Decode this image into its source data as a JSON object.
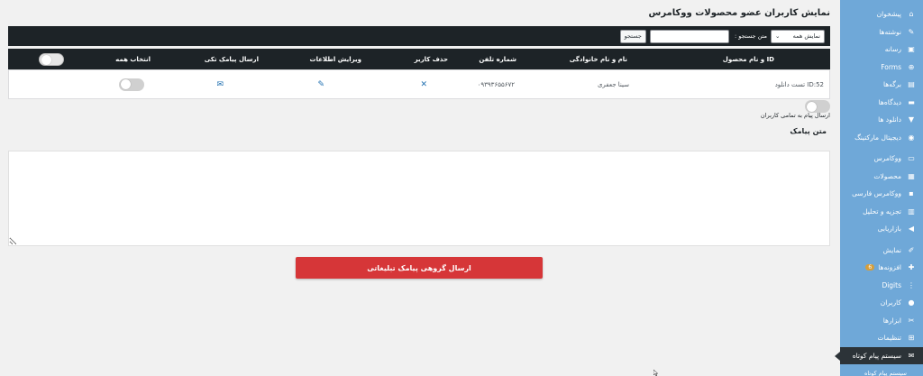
{
  "page": {
    "title": "نمایش کاربران عضو محصولات ووکامرس"
  },
  "toolbar": {
    "filter_value": "نمایش همه",
    "search_label": "متن جستجو :",
    "search_placeholder": "",
    "search_button": "جستجو"
  },
  "table": {
    "columns": {
      "id_product": "ID و نام محصول",
      "name": "نام و نام خانوادگی",
      "phone": "شماره تلفن",
      "delete": "حذف کاربر",
      "edit": "ویرایش اطلاعات",
      "single_sms": "ارسال پیامک تکی",
      "select_all": "انتخاب همه"
    },
    "rows": [
      {
        "id_product": "ID:52 تست دانلود",
        "name": "سینا جعفری",
        "phone": "۰۹۳۹۳۶۵۵۶۷۲"
      }
    ]
  },
  "bulk": {
    "all_users_label": "ارسال پیام به تمامی کاربران",
    "message_label": "متن پیامک",
    "message_value": "",
    "send_button": "ارسال گروهی پیامک تبلیغاتی"
  },
  "sidebar": {
    "items": [
      {
        "label": "پیشخوان",
        "icon": "dashboard-icon",
        "glyph": "⌂"
      },
      {
        "label": "نوشته‌ها",
        "icon": "pin-icon",
        "glyph": "✎"
      },
      {
        "label": "رسانه",
        "icon": "media-icon",
        "glyph": "▣"
      },
      {
        "label": "Forms",
        "icon": "forms-icon",
        "glyph": "⊕"
      },
      {
        "label": "برگه‌ها",
        "icon": "pages-icon",
        "glyph": "▤"
      },
      {
        "label": "دیدگاه‌ها",
        "icon": "comments-icon",
        "glyph": "▬"
      },
      {
        "label": "دانلود ها",
        "icon": "download-icon",
        "glyph": "▼"
      },
      {
        "label": "دیجیتال مارکتینگ",
        "icon": "marketing-icon",
        "glyph": "◉"
      },
      {
        "label": "ووکامرس",
        "icon": "woocommerce-icon",
        "glyph": "▭"
      },
      {
        "label": "محصولات",
        "icon": "products-icon",
        "glyph": "▦"
      },
      {
        "label": "ووکامرس فارسی",
        "icon": "woo-persian-icon",
        "glyph": "▪"
      },
      {
        "label": "تجزیه و تحلیل",
        "icon": "analytics-icon",
        "glyph": "▥"
      },
      {
        "label": "بازاریابی",
        "icon": "megaphone-icon",
        "glyph": "◀"
      },
      {
        "label": "نمایش",
        "icon": "appearance-icon",
        "glyph": "✐"
      },
      {
        "label": "افزونه‌ها",
        "icon": "plugins-icon",
        "glyph": "✚",
        "badge": "6"
      },
      {
        "label": "Digits",
        "icon": "digits-icon",
        "glyph": "⋮"
      },
      {
        "label": "کاربران",
        "icon": "users-icon",
        "glyph": "●"
      },
      {
        "label": "ابزارها",
        "icon": "tools-icon",
        "glyph": "✂"
      },
      {
        "label": "تنظیمات",
        "icon": "settings-icon",
        "glyph": "⊞"
      }
    ],
    "active_item": {
      "label": "سیستم پیام کوتاه",
      "icon": "sms-icon",
      "glyph": "✉"
    },
    "submenu_item": "سیستم پیام کوتاه"
  },
  "colors": {
    "sidebar": "#6fa8d8",
    "dark_header": "#1d2327",
    "send_button": "#d63638",
    "icon_accent": "#2271b1"
  }
}
